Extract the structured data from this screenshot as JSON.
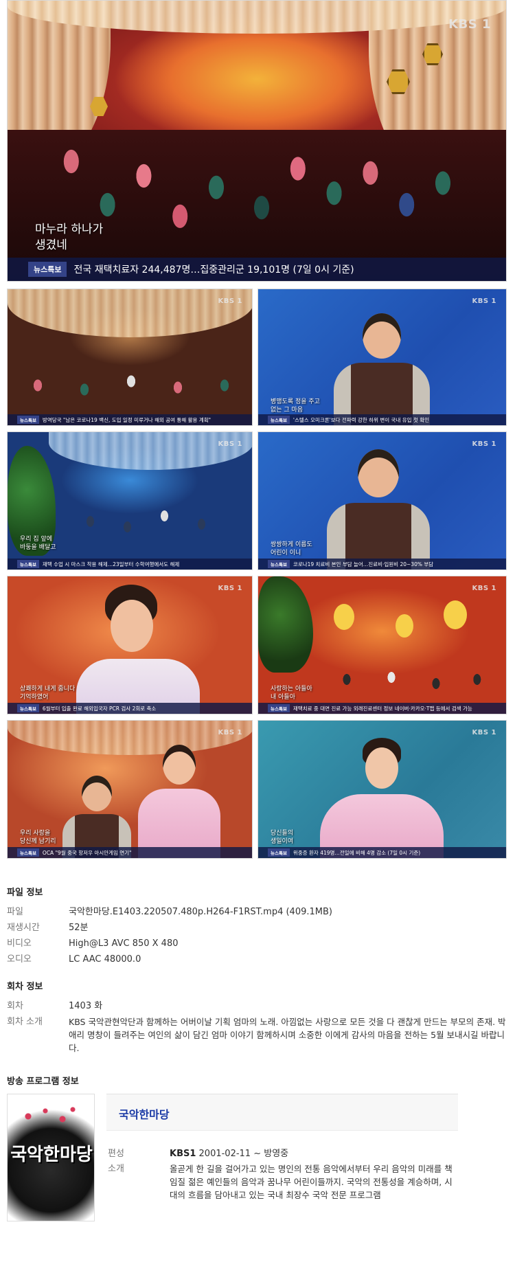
{
  "hero": {
    "logo": "KBS 1",
    "caption": "마누라 하나가\n생겼네",
    "ticker_tag": "뉴스특보",
    "ticker_text": "전국 재택치료자 244,487명…집중관리군 19,101명 (7일 0시 기준)"
  },
  "thumbs": [
    {
      "logo": "KBS 1",
      "caption": "",
      "ticker_tag": "뉴스특보",
      "ticker_text": "방역당국 \"남은 코로나19 백신, 도입 일정 미루거나 해외 공여 통해 활용 계획\""
    },
    {
      "logo": "KBS 1",
      "caption": "병맹도록 정을 주고\n없는 그 마음",
      "ticker_tag": "뉴스특보",
      "ticker_text": "'스텔스 오미크론'보다 전파력 강한 하위 변이 국내 유입 첫 확인"
    },
    {
      "logo": "KBS 1",
      "caption": "우리 집 앞에\n바둥을 배달고",
      "ticker_tag": "뉴스특보",
      "ticker_text": "재택 수업 시 마스크 착용 해제…23일부터 수학여행에서도 해제"
    },
    {
      "logo": "KBS 1",
      "caption": "쌍쌍하게 이름도\n어린이 이니",
      "ticker_tag": "뉴스특보",
      "ticker_text": "코로나19 치료비 본인 부담 늘어…진료비·입원비 20~30% 부담"
    },
    {
      "logo": "KBS 1",
      "caption": "상쾌하게 내게 줍니다\n기억하였어",
      "ticker_tag": "뉴스특보",
      "ticker_text": "6월부터 입출 완료 해외입국자 PCR 검사 2회로 축소"
    },
    {
      "logo": "KBS 1",
      "caption": "사랑하는 아들아\n내 아들아",
      "ticker_tag": "뉴스특보",
      "ticker_text": "재택치료 중 대면 진료 가능 외래진료센터 정보 네이버·카카오·T맵 등에서 검색 가능"
    },
    {
      "logo": "KBS 1",
      "caption": "우리 사랑을\n당신께 남기리",
      "ticker_tag": "뉴스특보",
      "ticker_text": "OCA \"9월 중국 항저우 아시안게임 연기\""
    },
    {
      "logo": "KBS 1",
      "caption": "당신들의\n생일이여",
      "ticker_tag": "뉴스특보",
      "ticker_text": "위중증 환자 419명…전일에 비해 4명 감소 (7일 0시 기준)"
    }
  ],
  "file_info": {
    "title": "파일 정보",
    "rows": [
      {
        "key": "파일",
        "value": "국악한마당.E1403.220507.480p.H264-F1RST.mp4 (409.1MB)"
      },
      {
        "key": "재생시간",
        "value": "52분"
      },
      {
        "key": "비디오",
        "value": "High@L3 AVC 850 X 480"
      },
      {
        "key": "오디오",
        "value": "LC AAC 48000.0"
      }
    ]
  },
  "episode_info": {
    "title": "회차 정보",
    "rows": [
      {
        "key": "회차",
        "value": "1403 화"
      },
      {
        "key": "회차 소개",
        "value": "KBS 국악관현악단과 함께하는 어버이날 기획 엄마의 노래. 아낌없는 사랑으로 모든 것을 다 괜찮게 만드는 부모의 존재. 박애리 명창이 들려주는 여인의 삶이 담긴 엄마 이야기 함께하시며 소중한 이에게 감사의 마음을 전하는 5월 보내시길 바랍니다."
      }
    ]
  },
  "program_info": {
    "section_title": "방송 프로그램 정보",
    "poster_text": "국악한마당",
    "title": "국악한마당",
    "rows": [
      {
        "key": "편성",
        "channel": "KBS1",
        "value": " 2001-02-11 ~ 방영중"
      },
      {
        "key": "소개",
        "value": "올곧게 한 길을 걸어가고 있는 명인의 전통 음악에서부터 우리 음악의 미래를 책임질 젊은 예인들의 음악과 꿈나무 어린이들까지. 국악의 전통성을 계승하며, 시대의 흐름을 담아내고 있는 국내 최장수 국악 전문 프로그램"
      }
    ]
  },
  "colors": {
    "ticker_bg": "#101846",
    "program_title": "#1a3aa6"
  }
}
